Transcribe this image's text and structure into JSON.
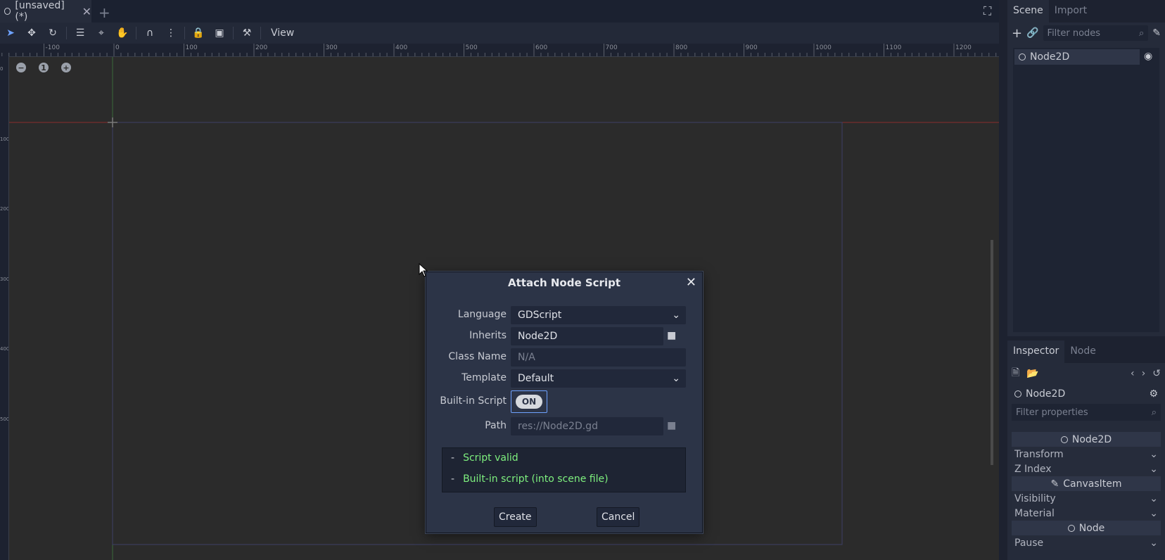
{
  "scene_tab": {
    "title": "[unsaved](*)",
    "close": "✕"
  },
  "add_tab": "+",
  "fullscreen": "⛶",
  "toolbar": {
    "view_menu": "View"
  },
  "ruler": {
    "top_labels": [
      "-100",
      "0",
      "100",
      "200",
      "300",
      "400",
      "500",
      "600",
      "700",
      "800",
      "900",
      "1000",
      "1100",
      "1200"
    ],
    "left_labels": [
      "0",
      "100",
      "200",
      "300",
      "400",
      "500"
    ]
  },
  "zoom": {
    "minus": "−",
    "reset": "1",
    "plus": "+"
  },
  "scene_dock": {
    "tabs": [
      "Scene",
      "Import"
    ],
    "filter_placeholder": "Filter nodes",
    "tree_root": "Node2D"
  },
  "inspector": {
    "tabs": [
      "Inspector",
      "Node"
    ],
    "node_name": "Node2D",
    "filter_placeholder": "Filter properties",
    "sections": [
      {
        "type": "section",
        "label": "Node2D",
        "icon": "circle-icon"
      },
      {
        "type": "prop",
        "label": "Transform"
      },
      {
        "type": "prop",
        "label": "Z Index"
      },
      {
        "type": "section",
        "label": "CanvasItem",
        "icon": "pencil-icon"
      },
      {
        "type": "prop",
        "label": "Visibility"
      },
      {
        "type": "prop",
        "label": "Material"
      },
      {
        "type": "section",
        "label": "Node",
        "icon": "circle-icon"
      },
      {
        "type": "prop",
        "label": "Pause"
      }
    ]
  },
  "dialog": {
    "title": "Attach Node Script",
    "close": "✕",
    "language_label": "Language",
    "language_value": "GDScript",
    "inherits_label": "Inherits",
    "inherits_value": "Node2D",
    "class_name_label": "Class Name",
    "class_name_placeholder": "N/A",
    "template_label": "Template",
    "template_value": "Default",
    "builtin_label": "Built-in Script",
    "builtin_toggle": "ON",
    "path_label": "Path",
    "path_value": "res://Node2D.gd",
    "status": [
      "Script valid",
      "Built-in script (into scene file)"
    ],
    "create_button": "Create",
    "cancel_button": "Cancel"
  },
  "colors": {
    "accent": "#6ea2ff",
    "valid": "#7ef07e",
    "x_axis": "#c0392b",
    "y_axis": "#3b7a3b"
  }
}
